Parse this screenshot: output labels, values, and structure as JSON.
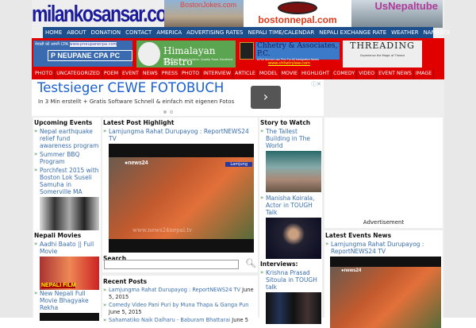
{
  "header": {
    "logo": "milankosansar.com",
    "banners": [
      "BostonJokes.com",
      "bostonnepal.com",
      "UsNepaltube"
    ]
  },
  "nav": [
    "HOME",
    "ABOUT",
    "DONATION",
    "CONTACT",
    "AMERICA",
    "ADVERTISING RATES",
    "NEPALI TIME/CALENDAR",
    "NEPALI EXCHANGE RATE",
    "WEATHER",
    "NAMASTE"
  ],
  "sponsors": {
    "cpa_top": "नेपाली को आफ्नै CPA",
    "cpa_url": "www.pneupanecpa.com",
    "cpa_name": "P NEUPANE CPA PC",
    "bistro": "Himalayan Bistro",
    "bistro_sub": "Indian and Nepali Cuisine. Quality Food. Excellent Services",
    "law": "Chhetry & Associates, P.C.",
    "law_sub": "A Full Service Law Firm For All Immigration Needs",
    "law_url": "www.chhetrylaw.com",
    "threading": "THREADING",
    "threading_sub": "Experience the Magic of Thread"
  },
  "categories": [
    "PHOTO",
    "UNCATEGORIZED",
    "POEM",
    "EVENT",
    "NEWS",
    "PRESS",
    "PHOTO",
    "INTERVIEW",
    "ARTICLE",
    "MODEL",
    "MOVIE",
    "HIGHLIGHT",
    "COMEDY",
    "VIDEO",
    "EVENT NEWS",
    "IMAGE"
  ],
  "ad": {
    "title": "Testsieger CEWE FOTOBUCH",
    "text": "In 3 Min erstellt + Gratis Software Schnell & einfach mit eigenen Fotos"
  },
  "upcoming": {
    "title": "Upcoming Events",
    "items": [
      "Nepal earthquake relief fund awareness program",
      "Summer BBQ Program",
      "Porchfest 2015 with Boston Lok Suseli Samuha in Somerville MA"
    ]
  },
  "movies": {
    "title": "Nepali Movies",
    "items": [
      "Aadhi Baato || Full Movie",
      "New Nepali Full Movie Bhagyake Rekha"
    ],
    "poster": "NEPALI FILM"
  },
  "highlight": {
    "title": "Latest Post Highlight",
    "item": "Lamjungma Rahat Durupayog : ReportNEWS24 TV",
    "video_tag": "Lamjung",
    "watermark": "www.news24nepal.tv"
  },
  "search": {
    "title": "Search",
    "placeholder": ""
  },
  "recent": {
    "title": "Recent Posts",
    "items": [
      {
        "t": "Lamjungma Rahat Durupayog : ReportNEWS24 TV",
        "d": "June 5, 2015"
      },
      {
        "t": "Comedy Video Pani Puri by Muna Thapa & Ganga Pun",
        "d": "June 5, 2015"
      },
      {
        "t": "Sahamatiko Naik Dalharu - Baburam Bhattarai",
        "d": "June 5"
      }
    ]
  },
  "story": {
    "title": "Story to Watch",
    "items": [
      "The Tallest Building in The World",
      "Manisha Koirala, Actor in TOUGH Talk"
    ]
  },
  "interviews": {
    "title": "Interviews:",
    "items": [
      "Krishna Prasad Sitoula in TOUGH talk"
    ]
  },
  "advert": "Advertisement",
  "events_news": {
    "title": "Latest Events News",
    "item": "Lamjungma Rahat Durupayog : ReportNEWS24 TV"
  }
}
